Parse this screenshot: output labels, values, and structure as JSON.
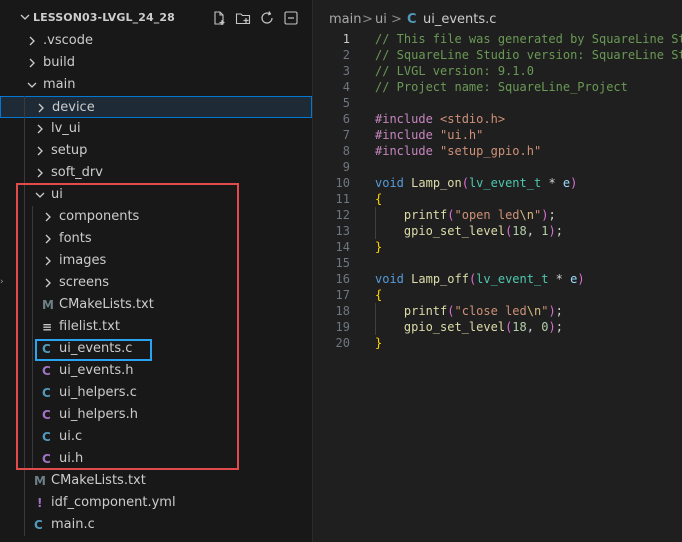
{
  "explorer": {
    "title": "LESSON03-LVGL_24_28",
    "actions": [
      "new-file-icon",
      "new-folder-icon",
      "refresh-icon",
      "collapse-all-icon"
    ],
    "items": [
      {
        "label": ".vscode",
        "type": "folder",
        "expanded": false
      },
      {
        "label": "build",
        "type": "folder",
        "expanded": false
      },
      {
        "label": "main",
        "type": "folder",
        "expanded": true
      },
      {
        "label": "device",
        "type": "folder",
        "expanded": false,
        "selected": true
      },
      {
        "label": "lv_ui",
        "type": "folder",
        "expanded": false
      },
      {
        "label": "setup",
        "type": "folder",
        "expanded": false
      },
      {
        "label": "soft_drv",
        "type": "folder",
        "expanded": false
      },
      {
        "label": "ui",
        "type": "folder",
        "expanded": true
      },
      {
        "label": "components",
        "type": "folder",
        "expanded": false
      },
      {
        "label": "fonts",
        "type": "folder",
        "expanded": false
      },
      {
        "label": "images",
        "type": "folder",
        "expanded": false
      },
      {
        "label": "screens",
        "type": "folder",
        "expanded": false
      },
      {
        "label": "CMakeLists.txt",
        "type": "cmake",
        "icon": "M"
      },
      {
        "label": "filelist.txt",
        "type": "text",
        "icon": "≡"
      },
      {
        "label": "ui_events.c",
        "type": "c",
        "icon": "C"
      },
      {
        "label": "ui_events.h",
        "type": "h",
        "icon": "C"
      },
      {
        "label": "ui_helpers.c",
        "type": "c",
        "icon": "C"
      },
      {
        "label": "ui_helpers.h",
        "type": "h",
        "icon": "C"
      },
      {
        "label": "ui.c",
        "type": "c",
        "icon": "C"
      },
      {
        "label": "ui.h",
        "type": "h",
        "icon": "C"
      },
      {
        "label": "CMakeLists.txt",
        "type": "cmake",
        "icon": "M"
      },
      {
        "label": "idf_component.yml",
        "type": "yml",
        "icon": "!"
      },
      {
        "label": "main.c",
        "type": "c",
        "icon": "C"
      }
    ]
  },
  "editor": {
    "breadcrumb": [
      "main",
      ">",
      "ui",
      ">",
      "C",
      "ui_events.c"
    ],
    "active_line": 1,
    "lines": [
      "// This file was generated by SquareLine Studio",
      "// SquareLine Studio version: SquareLine Studio",
      "// LVGL version: 9.1.0",
      "// Project name: SquareLine_Project",
      "",
      "#include <stdio.h>",
      "#include \"ui.h\"",
      "#include \"setup_gpio.h\"",
      "",
      "void Lamp_on(lv_event_t * e)",
      "{",
      "    printf(\"open led\\n\");",
      "    gpio_set_level(18, 1);",
      "}",
      "",
      "void Lamp_off(lv_event_t * e)",
      "{",
      "    printf(\"close led\\n\");",
      "    gpio_set_level(18, 0);",
      "}"
    ]
  },
  "colors": {
    "selection_border": "#0078d4",
    "highlight_red": "#e24b4b",
    "highlight_blue": "#2aa3f0",
    "c_icon": "#519aba",
    "h_icon": "#a074c4",
    "cmake_icon": "#6d8086",
    "yml_icon": "#a074c4"
  }
}
